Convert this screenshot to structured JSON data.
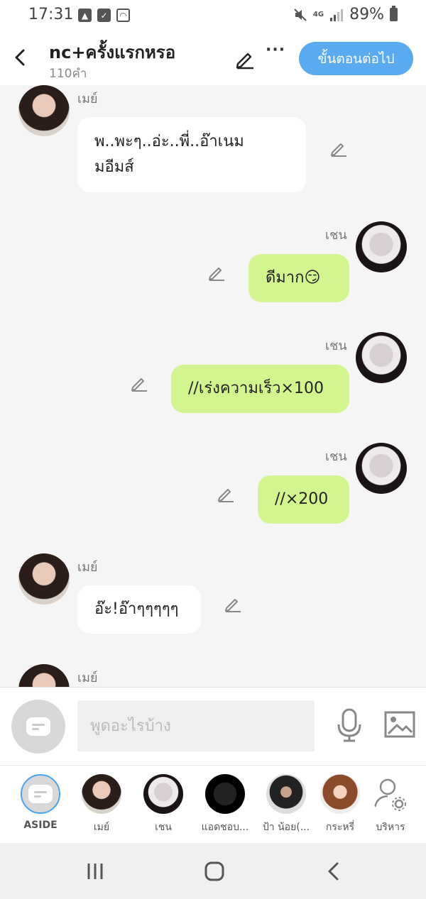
{
  "status_bar": {
    "time": "17:31",
    "network": "4G",
    "battery": "89%"
  },
  "header": {
    "title": "nc+ครั้งแรกหรอ",
    "subtitle": "110คำ",
    "next_label": "ขั้นตอนต่อไป"
  },
  "messages": [
    {
      "name": "เมย์",
      "text": "พ..พะๆ..อ่ะ..พี่..อ๊าเนม\nมอีมส์"
    },
    {
      "name": "เชน",
      "text": "ดีมาก😏"
    },
    {
      "name": "เชน",
      "text": "//เร่งความเร็ว×100"
    },
    {
      "name": "เชน",
      "text": "//×200"
    },
    {
      "name": "เมย์",
      "text": "อ๊ะ!อ๊าๆๆๆๆๆ"
    },
    {
      "name": "เมย์",
      "text": ""
    }
  ],
  "input": {
    "placeholder": "พูดอะไรบ้าง"
  },
  "characters": [
    {
      "label": "ASIDE"
    },
    {
      "label": "เมย์"
    },
    {
      "label": "เชน"
    },
    {
      "label": "แอดชอบ..."
    },
    {
      "label": "ป้า น้อย(..."
    },
    {
      "label": "กระหรี่"
    },
    {
      "label": "บริหาร"
    }
  ],
  "colors": {
    "accent": "#5aaaf0",
    "outgoing_bubble": "#d3f58f",
    "incoming_bubble": "#ffffff",
    "background": "#f5f5f5"
  },
  "icons": [
    "back-icon",
    "pencil-icon",
    "more-icon",
    "mic-icon",
    "image-icon",
    "aside-icon",
    "manage-icon",
    "recents-icon",
    "home-icon",
    "nav-back-icon"
  ]
}
